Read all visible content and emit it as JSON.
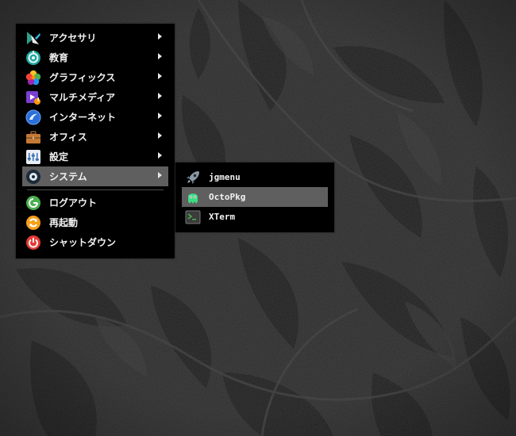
{
  "main_menu": {
    "items": [
      {
        "label": "アクセサリ",
        "icon": "accessories-icon",
        "has_submenu": true
      },
      {
        "label": "教育",
        "icon": "education-icon",
        "has_submenu": true
      },
      {
        "label": "グラフィックス",
        "icon": "graphics-icon",
        "has_submenu": true
      },
      {
        "label": "マルチメディア",
        "icon": "multimedia-icon",
        "has_submenu": true
      },
      {
        "label": "インターネット",
        "icon": "internet-icon",
        "has_submenu": true
      },
      {
        "label": "オフィス",
        "icon": "office-icon",
        "has_submenu": true
      },
      {
        "label": "設定",
        "icon": "settings-icon",
        "has_submenu": true
      },
      {
        "label": "システム",
        "icon": "system-icon",
        "has_submenu": true,
        "selected": true
      }
    ],
    "actions": [
      {
        "label": "ログアウト",
        "icon": "logout-icon"
      },
      {
        "label": "再起動",
        "icon": "reboot-icon"
      },
      {
        "label": "シャットダウン",
        "icon": "shutdown-icon"
      }
    ]
  },
  "system_submenu": {
    "items": [
      {
        "label": "jgmenu",
        "icon": "rocket-icon"
      },
      {
        "label": "OctoPkg",
        "icon": "octopkg-icon",
        "selected": true
      },
      {
        "label": "XTerm",
        "icon": "terminal-icon"
      }
    ]
  },
  "colors": {
    "menu_background": "#000000",
    "selected_background": "#5f5f5f",
    "menu_text": "#f2f2f2",
    "wallpaper_base": "#2c2c2c"
  }
}
